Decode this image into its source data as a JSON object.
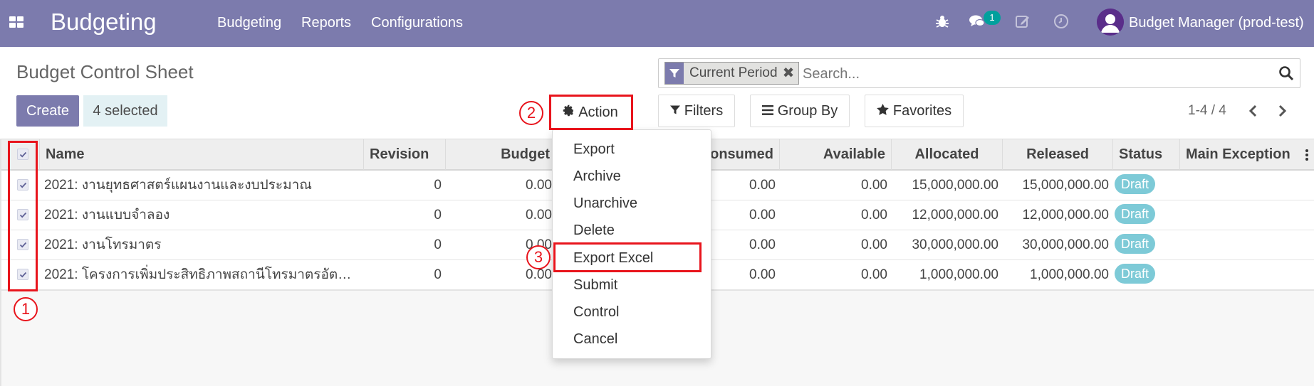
{
  "app": {
    "title": "Budgeting",
    "menu": [
      "Budgeting",
      "Reports",
      "Configurations"
    ],
    "chat_badge": "1",
    "user_name": "Budget Manager (prod-test)",
    "nav_color": "#7c7bad"
  },
  "control_panel": {
    "page_title": "Budget Control Sheet",
    "create_label": "Create",
    "selected_label": "4 selected",
    "action_label": "Action",
    "filters_label": "Filters",
    "group_by_label": "Group By",
    "favorites_label": "Favorites",
    "pager": "1-4 / 4",
    "search": {
      "facet": "Current Period",
      "placeholder": "Search..."
    }
  },
  "table": {
    "columns": [
      "Name",
      "Revision",
      "Budget",
      "Consumed",
      "Available",
      "Allocated",
      "Released",
      "Status",
      "Main Exception"
    ],
    "rows": [
      {
        "name": "2021: งานยุทธศาสตร์แผนงานและงบประมาณ",
        "revision": "0",
        "budget": "0.00",
        "consumed": "0.00",
        "available": "0.00",
        "allocated": "15,000,000.00",
        "released": "15,000,000.00",
        "status": "Draft",
        "selected": true
      },
      {
        "name": "2021: งานแบบจำลอง",
        "revision": "0",
        "budget": "0.00",
        "consumed": "0.00",
        "available": "0.00",
        "allocated": "12,000,000.00",
        "released": "12,000,000.00",
        "status": "Draft",
        "selected": true
      },
      {
        "name": "2021: งานโทรมาตร",
        "revision": "0",
        "budget": "0.00",
        "consumed": "0.00",
        "available": "0.00",
        "allocated": "30,000,000.00",
        "released": "30,000,000.00",
        "status": "Draft",
        "selected": true
      },
      {
        "name": "2021: โครงการเพิ่มประสิทธิภาพสถานีโทรมาตรอัต…",
        "revision": "0",
        "budget": "0.00",
        "consumed": "0.00",
        "available": "0.00",
        "allocated": "1,000,000.00",
        "released": "1,000,000.00",
        "status": "Draft",
        "selected": true
      }
    ]
  },
  "action_menu": {
    "items": [
      "Export",
      "Archive",
      "Unarchive",
      "Delete",
      "Export Excel",
      "Submit",
      "Control",
      "Cancel"
    ]
  },
  "annotations": {
    "step1": "1",
    "step2": "2",
    "step3": "3",
    "highlight_color": "#e8141c"
  }
}
